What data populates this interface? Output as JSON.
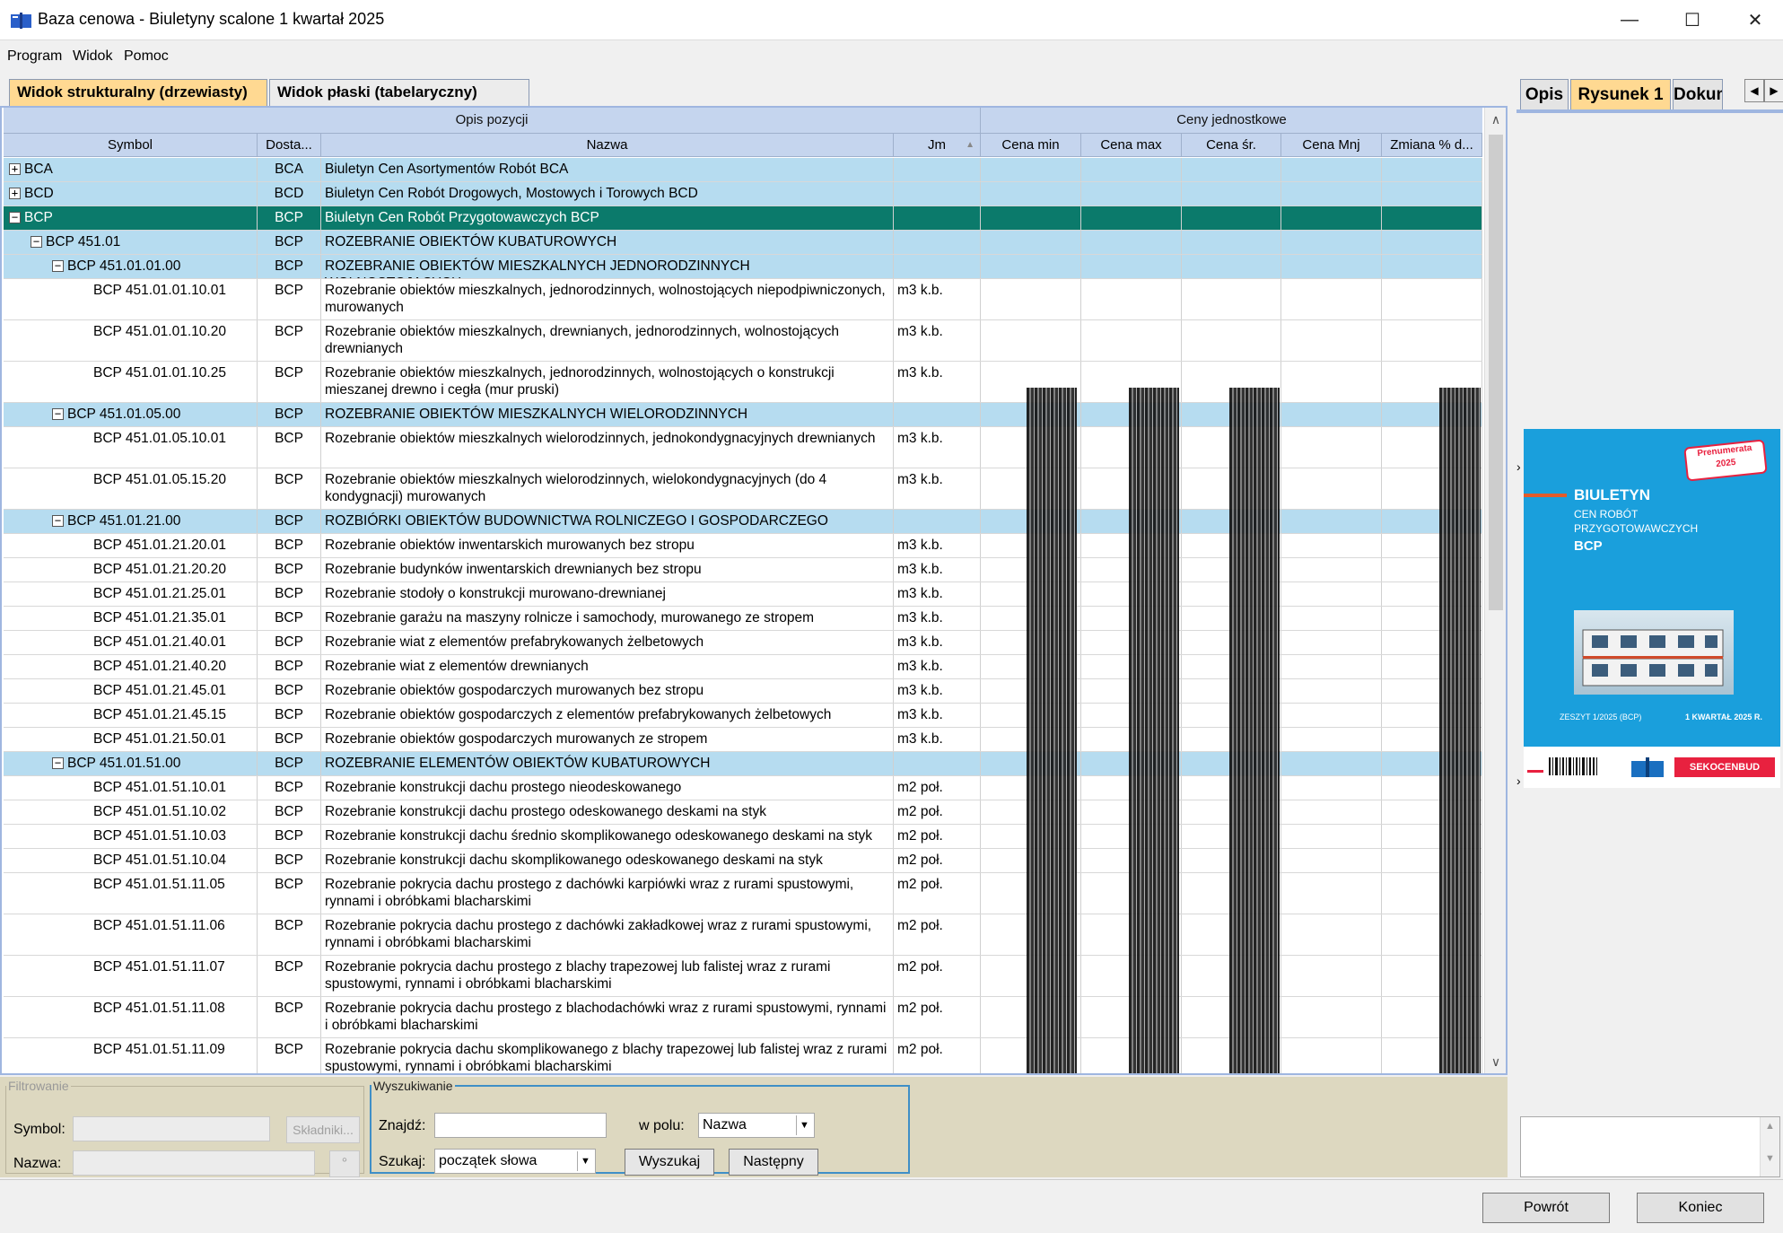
{
  "window": {
    "title": "Baza cenowa - Biuletyny scalone 1 kwartał 2025",
    "min": "—",
    "max": "☐",
    "close": "✕"
  },
  "menu": [
    "Program",
    "Widok",
    "Pomoc"
  ],
  "tabs": {
    "structural": "Widok strukturalny (drzewiasty)",
    "flat": "Widok płaski (tabelaryczny)"
  },
  "grid": {
    "group_headers": {
      "opis": "Opis pozycji",
      "ceny": "Ceny jednostkowe"
    },
    "columns": {
      "symbol": "Symbol",
      "dostawca": "Dosta...",
      "nazwa": "Nazwa",
      "jm": "Jm",
      "cena_min": "Cena min",
      "cena_max": "Cena max",
      "cena_sr": "Cena śr.",
      "cena_mnj": "Cena Mnj",
      "zmiana": "Zmiana % d..."
    },
    "sort_indicator": "▲",
    "rows": [
      {
        "symbol": "BCA",
        "dos": "BCA",
        "nazwa": "Biuletyn Cen Asortymentów Robót BCA",
        "jm": "",
        "type": "grp",
        "level": 0,
        "exp": "+"
      },
      {
        "symbol": "BCD",
        "dos": "BCD",
        "nazwa": "Biuletyn Cen Robót Drogowych, Mostowych i Torowych BCD",
        "jm": "",
        "type": "grp",
        "level": 0,
        "exp": "+"
      },
      {
        "symbol": "BCP",
        "dos": "BCP",
        "nazwa": "Biuletyn Cen Robót Przygotowawczych BCP",
        "jm": "",
        "type": "sel",
        "level": 0,
        "exp": "−"
      },
      {
        "symbol": "BCP 451.01",
        "dos": "BCP",
        "nazwa": "ROZEBRANIE OBIEKTÓW KUBATUROWYCH",
        "jm": "",
        "type": "grp",
        "level": 1,
        "exp": "−"
      },
      {
        "symbol": "BCP 451.01.01.00",
        "dos": "BCP",
        "nazwa": "ROZEBRANIE OBIEKTÓW MIESZKALNYCH JEDNORODZINNYCH WOLNOSTOJĄCYCH",
        "jm": "",
        "type": "grp",
        "level": 2,
        "exp": "−"
      },
      {
        "symbol": "BCP 451.01.01.10.01",
        "dos": "BCP",
        "nazwa": "Rozebranie obiektów mieszkalnych, jednorodzinnych, wolnostojących niepodpiwniczonych, murowanych",
        "jm": "m3 k.b.",
        "type": "item",
        "level": 3,
        "h": 2
      },
      {
        "symbol": "BCP 451.01.01.10.20",
        "dos": "BCP",
        "nazwa": "Rozebranie obiektów mieszkalnych, drewnianych, jednorodzinnych, wolnostojących drewnianych",
        "jm": "m3 k.b.",
        "type": "item",
        "level": 3,
        "h": 2
      },
      {
        "symbol": "BCP 451.01.01.10.25",
        "dos": "BCP",
        "nazwa": "Rozebranie obiektów mieszkalnych, jednorodzinnych, wolnostojących o konstrukcji mieszanej drewno i cegła (mur pruski)",
        "jm": "m3 k.b.",
        "type": "item",
        "level": 3,
        "h": 2
      },
      {
        "symbol": "BCP 451.01.05.00",
        "dos": "BCP",
        "nazwa": "ROZEBRANIE OBIEKTÓW MIESZKALNYCH WIELORODZINNYCH",
        "jm": "",
        "type": "grp",
        "level": 2,
        "exp": "−"
      },
      {
        "symbol": "BCP 451.01.05.10.01",
        "dos": "BCP",
        "nazwa": "Rozebranie obiektów mieszkalnych wielorodzinnych, jednokondygnacyjnych drewnianych",
        "jm": "m3 k.b.",
        "type": "item",
        "level": 3,
        "h": 2
      },
      {
        "symbol": "BCP 451.01.05.15.20",
        "dos": "BCP",
        "nazwa": "Rozebranie obiektów mieszkalnych wielorodzinnych, wielokondygnacyjnych (do 4 kondygnacji) murowanych",
        "jm": "m3 k.b.",
        "type": "item",
        "level": 3,
        "h": 2
      },
      {
        "symbol": "BCP 451.01.21.00",
        "dos": "BCP",
        "nazwa": "ROZBIÓRKI OBIEKTÓW BUDOWNICTWA ROLNICZEGO I GOSPODARCZEGO",
        "jm": "",
        "type": "grp",
        "level": 2,
        "exp": "−"
      },
      {
        "symbol": "BCP 451.01.21.20.01",
        "dos": "BCP",
        "nazwa": "Rozebranie obiektów inwentarskich murowanych bez stropu",
        "jm": "m3 k.b.",
        "type": "item",
        "level": 3
      },
      {
        "symbol": "BCP 451.01.21.20.20",
        "dos": "BCP",
        "nazwa": "Rozebranie budynków inwentarskich drewnianych bez stropu",
        "jm": "m3 k.b.",
        "type": "item",
        "level": 3
      },
      {
        "symbol": "BCP 451.01.21.25.01",
        "dos": "BCP",
        "nazwa": "Rozebranie stodoły o konstrukcji murowano-drewnianej",
        "jm": "m3 k.b.",
        "type": "item",
        "level": 3
      },
      {
        "symbol": "BCP 451.01.21.35.01",
        "dos": "BCP",
        "nazwa": "Rozebranie garażu na maszyny rolnicze i samochody, murowanego ze stropem",
        "jm": "m3 k.b.",
        "type": "item",
        "level": 3
      },
      {
        "symbol": "BCP 451.01.21.40.01",
        "dos": "BCP",
        "nazwa": "Rozebranie wiat z elementów prefabrykowanych żelbetowych",
        "jm": "m3 k.b.",
        "type": "item",
        "level": 3
      },
      {
        "symbol": "BCP 451.01.21.40.20",
        "dos": "BCP",
        "nazwa": "Rozebranie wiat z elementów drewnianych",
        "jm": "m3 k.b.",
        "type": "item",
        "level": 3
      },
      {
        "symbol": "BCP 451.01.21.45.01",
        "dos": "BCP",
        "nazwa": "Rozebranie obiektów gospodarczych murowanych bez stropu",
        "jm": "m3 k.b.",
        "type": "item",
        "level": 3
      },
      {
        "symbol": "BCP 451.01.21.45.15",
        "dos": "BCP",
        "nazwa": "Rozebranie obiektów gospodarczych z elementów prefabrykowanych żelbetowych",
        "jm": "m3 k.b.",
        "type": "item",
        "level": 3
      },
      {
        "symbol": "BCP 451.01.21.50.01",
        "dos": "BCP",
        "nazwa": "Rozebranie obiektów gospodarczych murowanych ze stropem",
        "jm": "m3 k.b.",
        "type": "item",
        "level": 3
      },
      {
        "symbol": "BCP 451.01.51.00",
        "dos": "BCP",
        "nazwa": "ROZEBRANIE ELEMENTÓW OBIEKTÓW KUBATUROWYCH",
        "jm": "",
        "type": "grp",
        "level": 2,
        "exp": "−"
      },
      {
        "symbol": "BCP 451.01.51.10.01",
        "dos": "BCP",
        "nazwa": "Rozebranie konstrukcji dachu prostego nieodeskowanego",
        "jm": "m2 poł.",
        "type": "item",
        "level": 3
      },
      {
        "symbol": "BCP 451.01.51.10.02",
        "dos": "BCP",
        "nazwa": "Rozebranie konstrukcji dachu prostego odeskowanego deskami na styk",
        "jm": "m2 poł.",
        "type": "item",
        "level": 3
      },
      {
        "symbol": "BCP 451.01.51.10.03",
        "dos": "BCP",
        "nazwa": "Rozebranie konstrukcji dachu średnio skomplikowanego odeskowanego deskami na styk",
        "jm": "m2 poł.",
        "type": "item",
        "level": 3
      },
      {
        "symbol": "BCP 451.01.51.10.04",
        "dos": "BCP",
        "nazwa": "Rozebranie konstrukcji dachu skomplikowanego odeskowanego deskami na styk",
        "jm": "m2 poł.",
        "type": "item",
        "level": 3
      },
      {
        "symbol": "BCP 451.01.51.11.05",
        "dos": "BCP",
        "nazwa": "Rozebranie pokrycia dachu prostego z dachówki karpiówki wraz z rurami spustowymi, rynnami i obróbkami blacharskimi",
        "jm": "m2 poł.",
        "type": "item",
        "level": 3,
        "h": 2
      },
      {
        "symbol": "BCP 451.01.51.11.06",
        "dos": "BCP",
        "nazwa": "Rozebranie pokrycia dachu prostego z dachówki zakładkowej wraz z rurami spustowymi, rynnami i obróbkami blacharskimi",
        "jm": "m2 poł.",
        "type": "item",
        "level": 3,
        "h": 2
      },
      {
        "symbol": "BCP 451.01.51.11.07",
        "dos": "BCP",
        "nazwa": "Rozebranie pokrycia dachu prostego z blachy trapezowej lub falistej wraz z rurami spustowymi, rynnami i obróbkami blacharskimi",
        "jm": "m2 poł.",
        "type": "item",
        "level": 3,
        "h": 2
      },
      {
        "symbol": "BCP 451.01.51.11.08",
        "dos": "BCP",
        "nazwa": "Rozebranie pokrycia dachu prostego z blachodachówki wraz z rurami spustowymi, rynnami i obróbkami blacharskimi",
        "jm": "m2 poł.",
        "type": "item",
        "level": 3,
        "h": 2
      },
      {
        "symbol": "BCP 451.01.51.11.09",
        "dos": "BCP",
        "nazwa": "Rozebranie pokrycia dachu skomplikowanego z blachy trapezowej lub falistej wraz z rurami spustowymi, rynnami i obróbkami blacharskimi",
        "jm": "m2 poł.",
        "type": "item",
        "level": 3,
        "h": 2
      }
    ]
  },
  "filter": {
    "legend": "Filtrowanie",
    "symbol_label": "Symbol:",
    "nazwa_label": "Nazwa:",
    "skladniki": "Składniki...",
    "dots": "°"
  },
  "search": {
    "legend": "Wyszukiwanie",
    "znajdz_label": "Znajdź:",
    "znajdz_value": "",
    "wpolu_label": "w polu:",
    "wpolu_value": "Nazwa",
    "szukaj_label": "Szukaj:",
    "szukaj_value": "początek słowa",
    "wyszukaj": "Wyszukaj",
    "nastepny": "Następny"
  },
  "right_panel": {
    "tabs": [
      "Opis",
      "Rysunek 1",
      "Dokum"
    ],
    "cover": {
      "stamp": "Prenumerata 2025",
      "title": "BIULETYN",
      "line1": "CEN ROBÓT",
      "line2": "PRZYGOTOWAWCZYCH",
      "code": "BCP",
      "issue": "ZESZYT 1/2025 (BCP)",
      "quarter": "1 KWARTAŁ 2025 R.",
      "brand": "SEKOCENBUD"
    }
  },
  "footer": {
    "powrot": "Powrót",
    "koniec": "Koniec"
  }
}
